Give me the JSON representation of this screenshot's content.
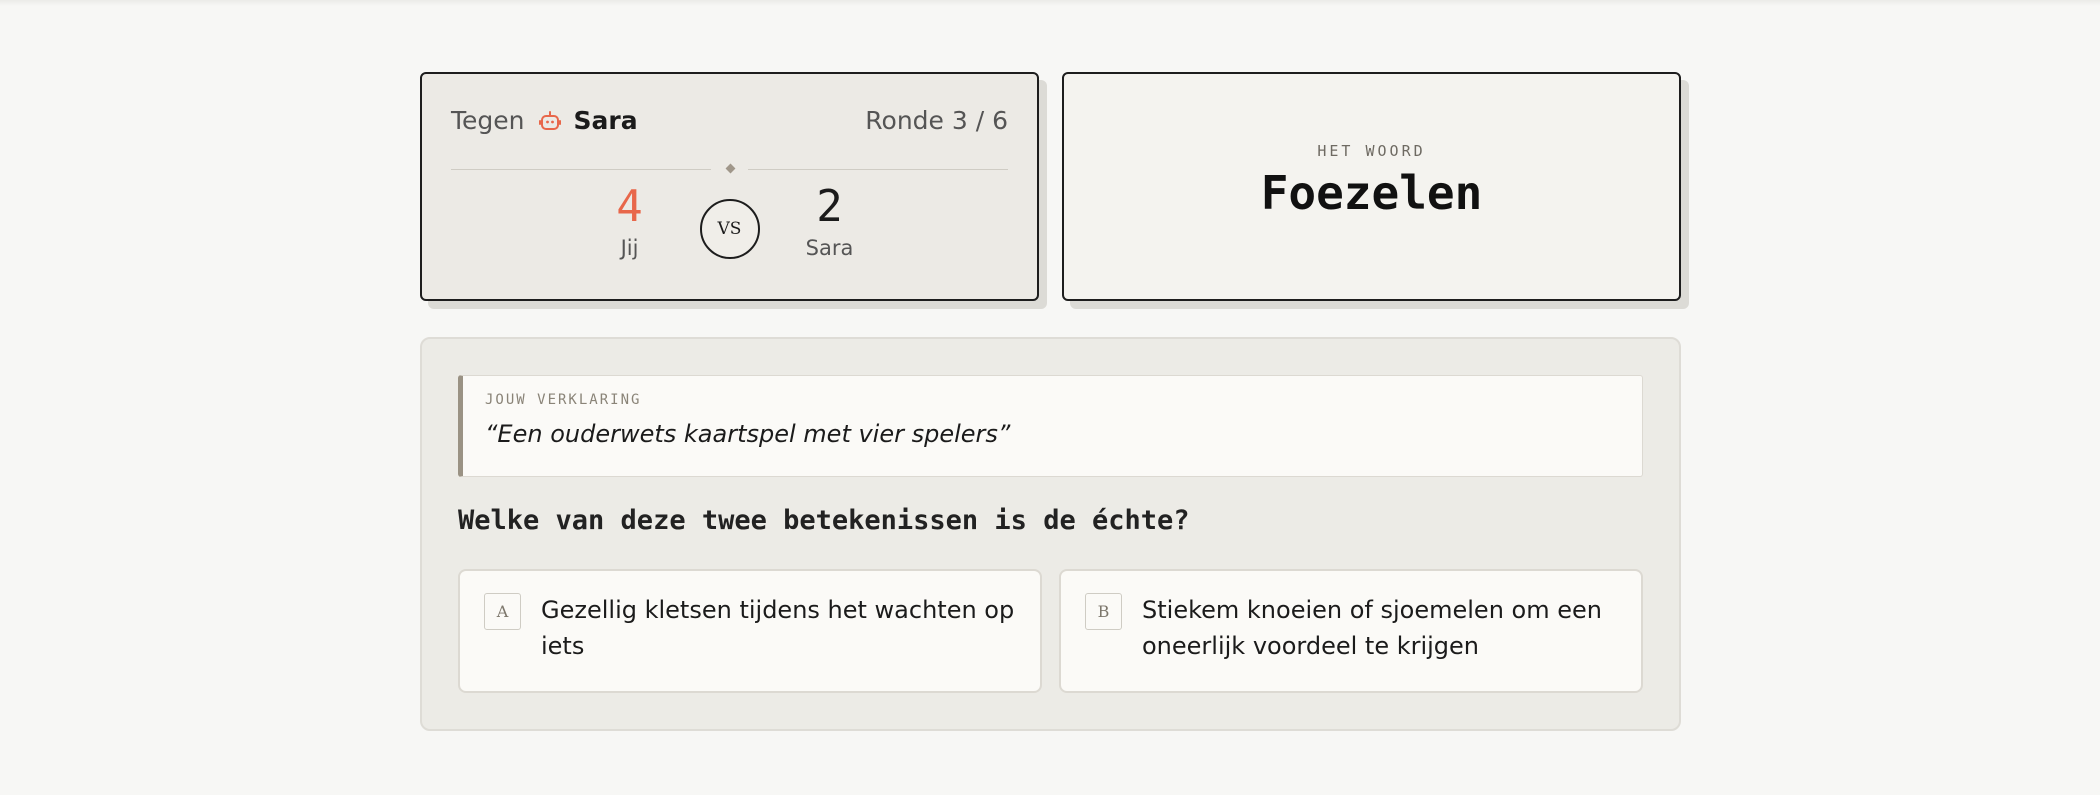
{
  "match": {
    "against_label": "Tegen",
    "opponent_name": "Sara",
    "round_text": "Ronde 3 / 6"
  },
  "scores": {
    "me": {
      "value": "4",
      "label": "Jij"
    },
    "vs_label": "VS",
    "opponent": {
      "value": "2",
      "label": "Sara"
    }
  },
  "word": {
    "label": "HET WOORD",
    "value": "Foezelen"
  },
  "explanation": {
    "label": "JOUW VERKLARING",
    "text": "“Een ouderwets kaartspel met vier spelers”"
  },
  "question": "Welke van deze twee betekenissen is de échte?",
  "options": [
    {
      "letter": "A",
      "text": "Gezellig kletsen tijdens het wachten op iets"
    },
    {
      "letter": "B",
      "text": "Stiekem knoeien of sjoemelen om een oneerlijk voordeel te krijgen"
    }
  ],
  "colors": {
    "accent": "#e8674a",
    "background": "#f7f7f5",
    "panel": "#ecebe6"
  },
  "icons": {
    "opponent": "robot-icon"
  }
}
